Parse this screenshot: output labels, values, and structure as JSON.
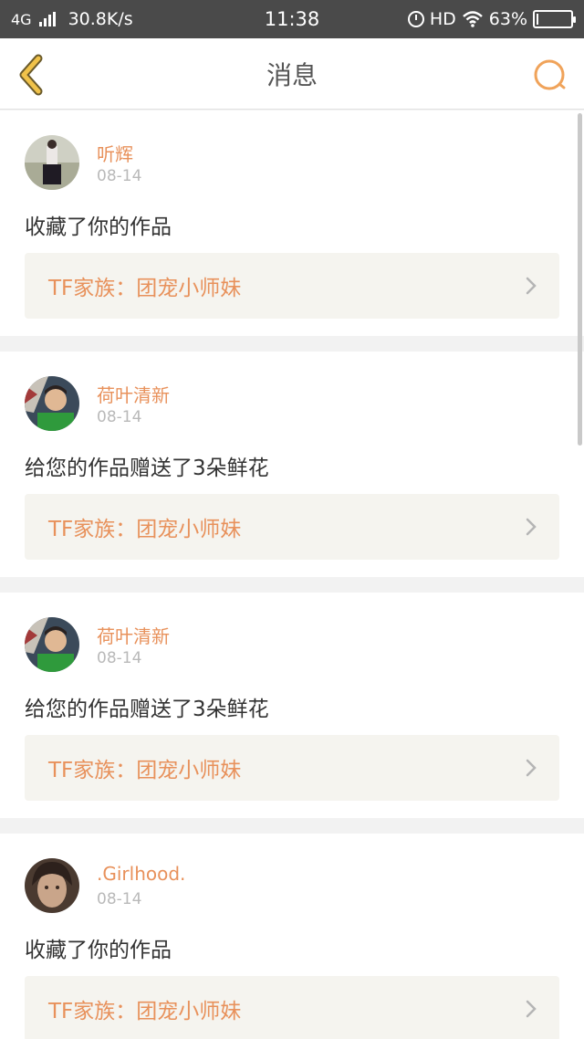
{
  "status": {
    "network": "4G",
    "speed": "30.8K/s",
    "time": "11:38",
    "hd": "HD",
    "battery": "63%"
  },
  "nav": {
    "title": "消息",
    "back_icon": "chevron-left-icon",
    "search_icon": "search-icon",
    "accent": "#e8a53a"
  },
  "messages": [
    {
      "user": "听辉",
      "date": "08-14",
      "action": "收藏了你的作品",
      "work": "TF家族：团宠小师妹"
    },
    {
      "user": "荷叶清新",
      "date": "08-14",
      "action": "给您的作品赠送了3朵鲜花",
      "work": "TF家族：团宠小师妹"
    },
    {
      "user": "荷叶清新",
      "date": "08-14",
      "action": "给您的作品赠送了3朵鲜花",
      "work": "TF家族：团宠小师妹"
    },
    {
      "user": ".Girlhood.",
      "date": "08-14",
      "action": "收藏了你的作品",
      "work": "TF家族：团宠小师妹"
    }
  ],
  "colors": {
    "username": "#e8915b",
    "work_box": "#f5f4ef"
  }
}
